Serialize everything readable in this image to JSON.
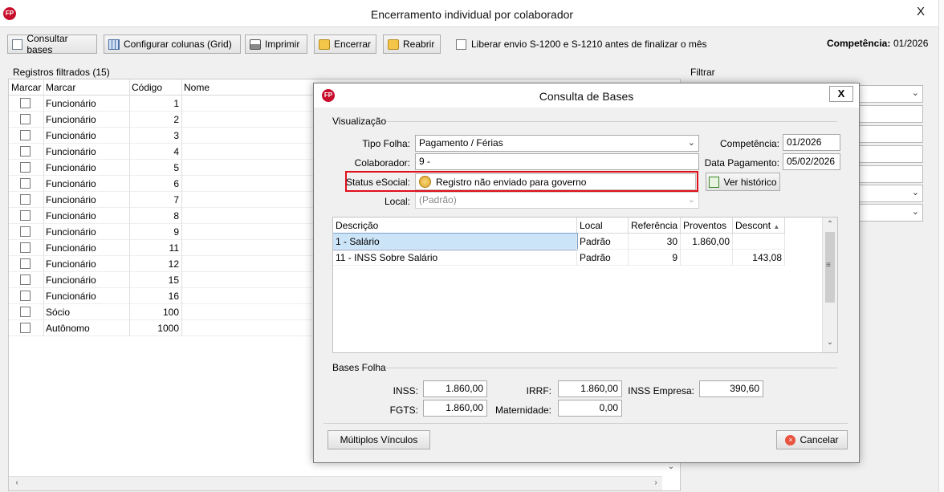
{
  "window": {
    "title": "Encerramento individual por colaborador",
    "close": "X"
  },
  "toolbar": {
    "consultar": "Consultar bases",
    "configurar": "Configurar colunas (Grid)",
    "imprimir": "Imprimir",
    "encerrar": "Encerrar",
    "reabrir": "Reabrir",
    "liberar": "Liberar envio S-1200 e S-1210 antes de finalizar o mês",
    "competencia_label": "Competência:",
    "competencia_value": "01/2026"
  },
  "registros": {
    "title": "Registros filtrados (15)",
    "headers": {
      "marcar": "Marcar",
      "tipo": "Marcar",
      "codigo": "Código",
      "nome": "Nome"
    },
    "rows": [
      {
        "tipo": "Funcionário",
        "codigo": "1"
      },
      {
        "tipo": "Funcionário",
        "codigo": "2"
      },
      {
        "tipo": "Funcionário",
        "codigo": "3"
      },
      {
        "tipo": "Funcionário",
        "codigo": "4"
      },
      {
        "tipo": "Funcionário",
        "codigo": "5"
      },
      {
        "tipo": "Funcionário",
        "codigo": "6"
      },
      {
        "tipo": "Funcionário",
        "codigo": "7"
      },
      {
        "tipo": "Funcionário",
        "codigo": "8"
      },
      {
        "tipo": "Funcionário",
        "codigo": "9"
      },
      {
        "tipo": "Funcionário",
        "codigo": "11"
      },
      {
        "tipo": "Funcionário",
        "codigo": "12"
      },
      {
        "tipo": "Funcionário",
        "codigo": "15"
      },
      {
        "tipo": "Funcionário",
        "codigo": "16"
      },
      {
        "tipo": "Sócio",
        "codigo": "100"
      },
      {
        "tipo": "Autônomo",
        "codigo": "1000"
      }
    ]
  },
  "filtrar": {
    "title": "Filtrar"
  },
  "modal": {
    "title": "Consulta de Bases",
    "close": "X",
    "visualizacao": "Visualização",
    "tipo_folha_label": "Tipo Folha:",
    "tipo_folha_value": "Pagamento / Férias",
    "colaborador_label": "Colaborador:",
    "colaborador_value": "9 -",
    "status_label": "Status eSocial:",
    "status_value": "Registro não enviado para governo",
    "local_label": "Local:",
    "local_value": "(Padrão)",
    "competencia_label": "Competência:",
    "competencia_value": "01/2026",
    "data_pagamento_label": "Data Pagamento:",
    "data_pagamento_value": "05/02/2026",
    "ver_historico": "Ver histórico",
    "grid_headers": {
      "descricao": "Descrição",
      "local": "Local",
      "referencia": "Referência",
      "proventos": "Proventos",
      "descontos": "Descont"
    },
    "grid_rows": [
      {
        "descricao": "1 - Salário",
        "local": "Padrão",
        "referencia": "30",
        "proventos": "1.860,00",
        "descontos": ""
      },
      {
        "descricao": "11 - INSS Sobre Salário",
        "local": "Padrão",
        "referencia": "9",
        "proventos": "",
        "descontos": "143,08"
      }
    ],
    "bases_folha": "Bases Folha",
    "inss_label": "INSS:",
    "inss_value": "1.860,00",
    "irrf_label": "IRRF:",
    "irrf_value": "1.860,00",
    "inss_empresa_label": "INSS Empresa:",
    "inss_empresa_value": "390,60",
    "fgts_label": "FGTS:",
    "fgts_value": "1.860,00",
    "maternidade_label": "Maternidade:",
    "maternidade_value": "0,00",
    "multiplos_vinculos": "Múltiplos Vínculos",
    "cancelar": "Cancelar"
  },
  "colors": {
    "highlight": "#e0101a",
    "selection": "#cce4f7",
    "logo": "#c8102e"
  }
}
